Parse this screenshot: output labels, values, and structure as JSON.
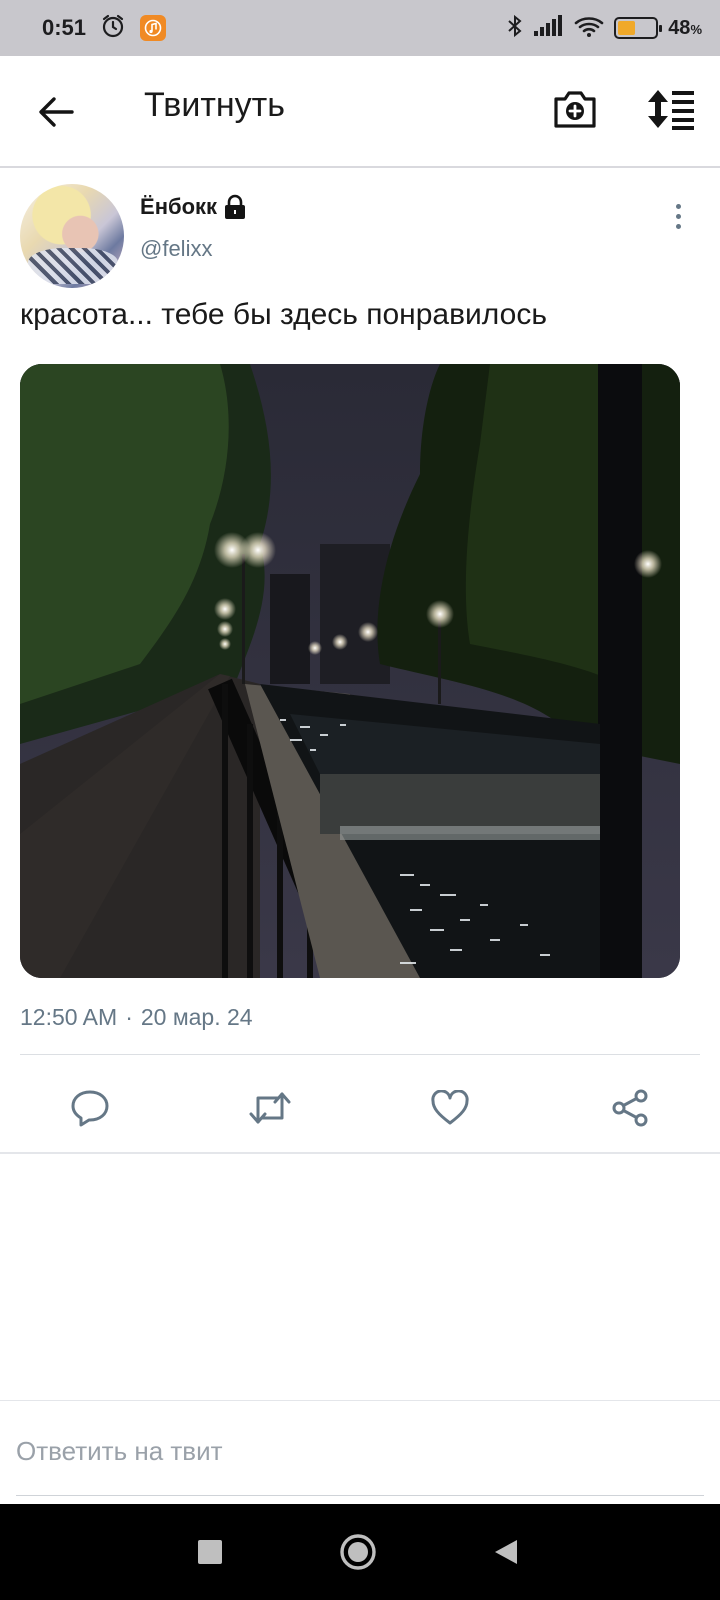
{
  "status_bar": {
    "time": "0:51",
    "battery_percent_text": "48",
    "battery_percent_unit": "%",
    "battery_level": 0.48,
    "icons": [
      "alarm-icon",
      "music-app-icon",
      "bluetooth-icon",
      "signal-icon",
      "wifi-icon",
      "battery-icon"
    ]
  },
  "app_bar": {
    "title": "Твитнуть",
    "icons": [
      "back-arrow-icon",
      "camera-add-icon",
      "sort-icon"
    ]
  },
  "tweet": {
    "author_name": "Ёнбокк",
    "author_handle": "@felixx",
    "locked": true,
    "text": "красота... тебе бы здесь понравилось",
    "time": "12:50 AM",
    "separator": "·",
    "date": "20 мар. 24",
    "actions": [
      "reply-icon",
      "retweet-icon",
      "like-icon",
      "share-icon"
    ]
  },
  "reply": {
    "placeholder": "Ответить на твит"
  },
  "colors": {
    "secondary_text": "#657786",
    "status_bar_bg": "#c8c7cc",
    "battery_fill": "#f0a92a",
    "music_badge": "#f08a24"
  }
}
